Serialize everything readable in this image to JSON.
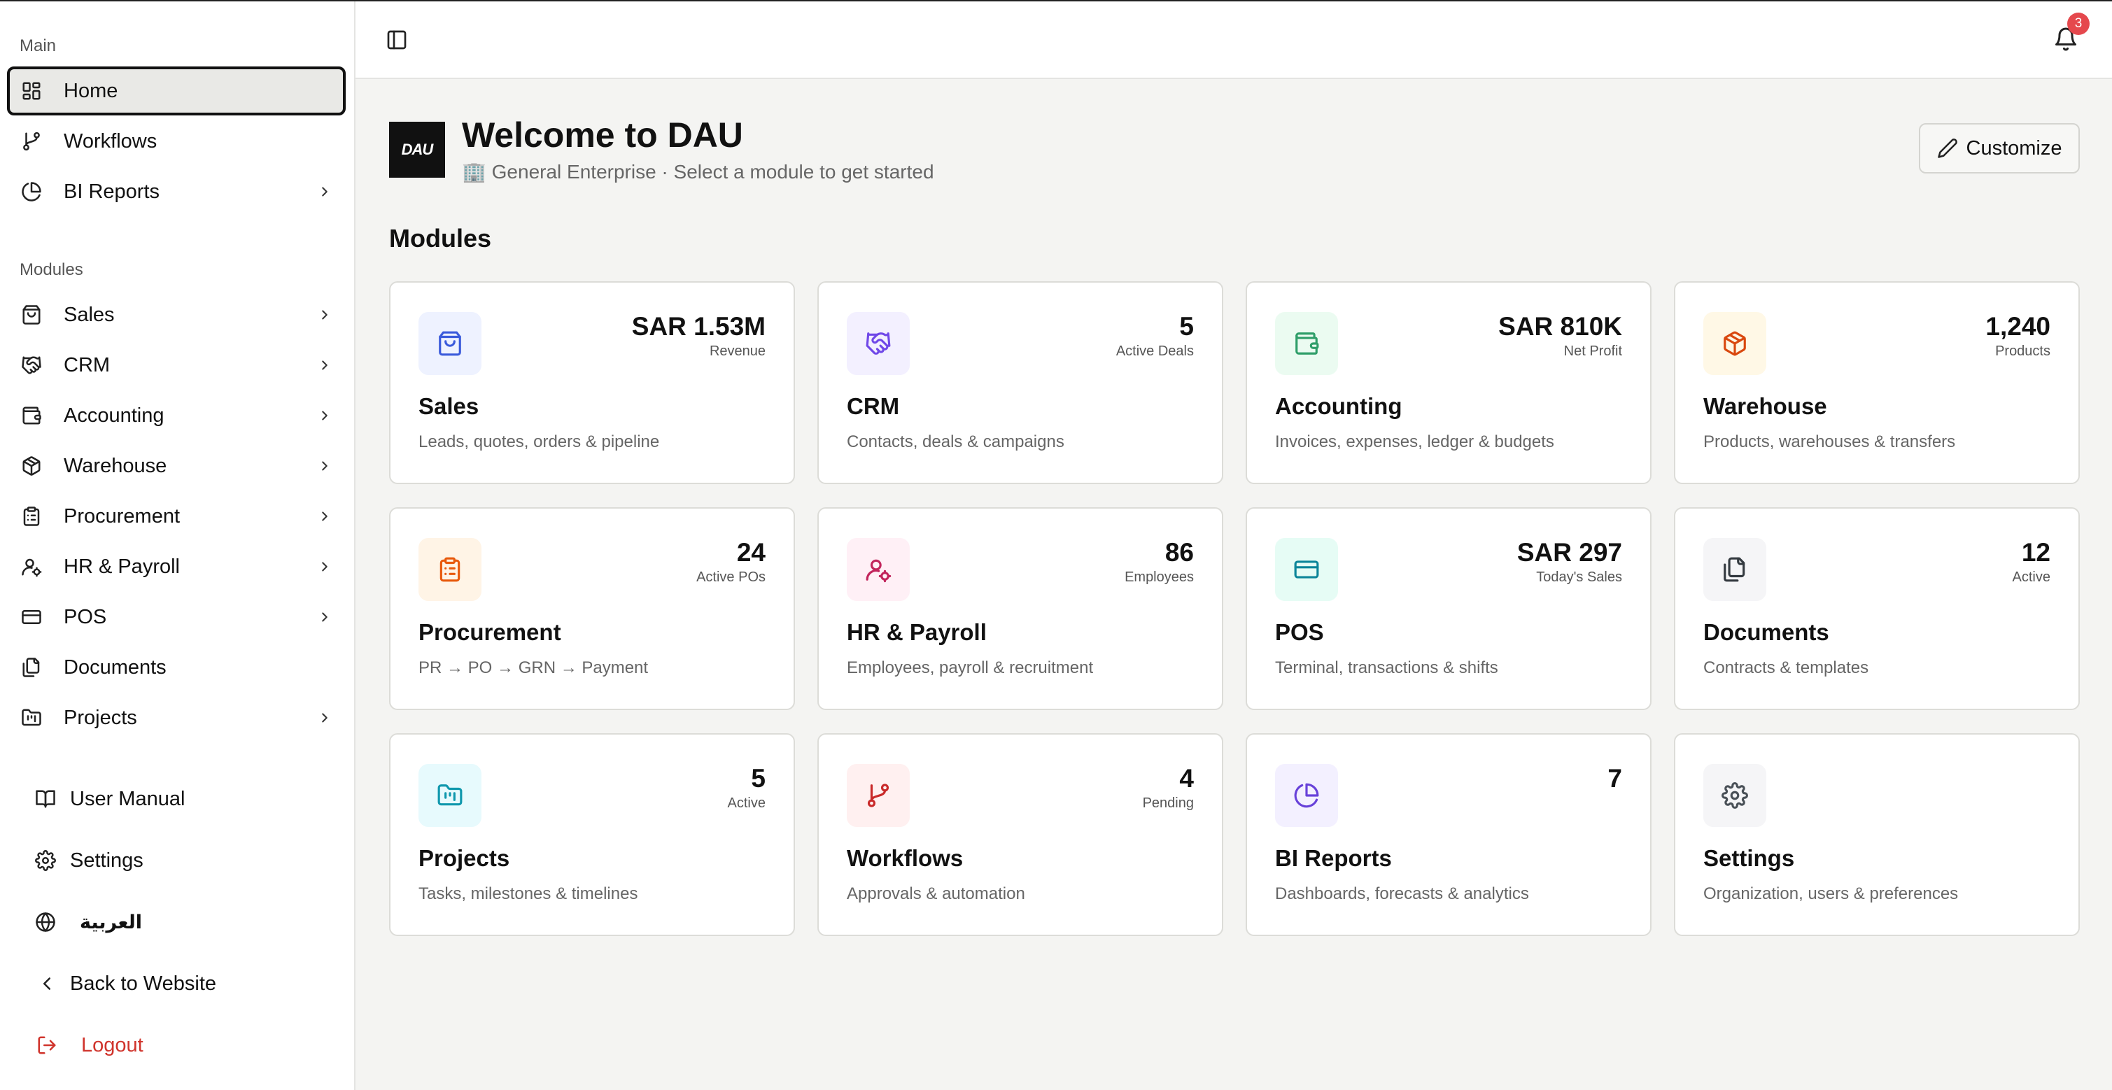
{
  "sidebar": {
    "main_label": "Main",
    "modules_label": "Modules",
    "main_items": [
      {
        "label": "Home",
        "icon": "grid-icon"
      },
      {
        "label": "Workflows",
        "icon": "git-branch-icon"
      },
      {
        "label": "BI Reports",
        "icon": "pie-chart-icon"
      }
    ],
    "module_items": [
      {
        "label": "Sales",
        "icon": "shopping-bag-icon"
      },
      {
        "label": "CRM",
        "icon": "handshake-icon"
      },
      {
        "label": "Accounting",
        "icon": "wallet-icon"
      },
      {
        "label": "Warehouse",
        "icon": "package-icon"
      },
      {
        "label": "Procurement",
        "icon": "clipboard-list-icon"
      },
      {
        "label": "HR & Payroll",
        "icon": "user-cog-icon"
      },
      {
        "label": "POS",
        "icon": "credit-card-icon"
      },
      {
        "label": "Documents",
        "icon": "files-icon"
      },
      {
        "label": "Projects",
        "icon": "folder-kanban-icon"
      }
    ],
    "footer_items": [
      {
        "label": "User Manual",
        "icon": "book-icon"
      },
      {
        "label": "Settings",
        "icon": "gear-icon"
      },
      {
        "label": "العربية",
        "icon": "globe-icon"
      },
      {
        "label": "Back to Website",
        "icon": "chevron-left-icon"
      },
      {
        "label": "Logout",
        "icon": "logout-icon"
      }
    ]
  },
  "header": {
    "notification_count": "3"
  },
  "welcome": {
    "logo_text": "DAU",
    "title": "Welcome to DAU",
    "subtitle": "🏢 General Enterprise · Select a module to get started",
    "customize_label": "Customize"
  },
  "modules_title": "Modules",
  "modules": [
    {
      "title": "Sales",
      "desc": "Leads, quotes, orders & pipeline",
      "value": "SAR 1.53M",
      "label": "Revenue",
      "icon": "shopping-bag-icon",
      "color": "#3b5bdb",
      "bg": "#eef2ff"
    },
    {
      "title": "CRM",
      "desc": "Contacts, deals & campaigns",
      "value": "5",
      "label": "Active Deals",
      "icon": "handshake-icon",
      "color": "#7048e8",
      "bg": "#f3f0ff"
    },
    {
      "title": "Accounting",
      "desc": "Invoices, expenses, ledger & budgets",
      "value": "SAR 810K",
      "label": "Net Profit",
      "icon": "wallet-icon",
      "color": "#2f9e69",
      "bg": "#ebfbf1"
    },
    {
      "title": "Warehouse",
      "desc": "Products, warehouses & transfers",
      "value": "1,240",
      "label": "Products",
      "icon": "package-icon",
      "color": "#d9480f",
      "bg": "#fff8e6"
    },
    {
      "title": "Procurement",
      "desc": "PR → PO → GRN → Payment",
      "value": "24",
      "label": "Active POs",
      "icon": "clipboard-list-icon",
      "color": "#e8590c",
      "bg": "#fff4e6"
    },
    {
      "title": "HR & Payroll",
      "desc": "Employees, payroll & recruitment",
      "value": "86",
      "label": "Employees",
      "icon": "user-cog-icon",
      "color": "#c2255c",
      "bg": "#fff0f6"
    },
    {
      "title": "POS",
      "desc": "Terminal, transactions & shifts",
      "value": "SAR 297",
      "label": "Today's Sales",
      "icon": "credit-card-icon",
      "color": "#0c8599",
      "bg": "#e6fcf5"
    },
    {
      "title": "Documents",
      "desc": "Contracts & templates",
      "value": "12",
      "label": "Active",
      "icon": "files-icon",
      "color": "#343a40",
      "bg": "#f5f5f7"
    },
    {
      "title": "Projects",
      "desc": "Tasks, milestones & timelines",
      "value": "5",
      "label": "Active",
      "icon": "folder-kanban-icon",
      "color": "#1098ad",
      "bg": "#e7fafd"
    },
    {
      "title": "Workflows",
      "desc": "Approvals & automation",
      "value": "4",
      "label": "Pending",
      "icon": "git-branch-icon",
      "color": "#c92a2a",
      "bg": "#fff0f0"
    },
    {
      "title": "BI Reports",
      "desc": "Dashboards, forecasts & analytics",
      "value": "7",
      "label": "",
      "icon": "pie-chart-icon",
      "color": "#6741d9",
      "bg": "#f3f0ff"
    },
    {
      "title": "Settings",
      "desc": "Organization, users & preferences",
      "value": "",
      "label": "",
      "icon": "gear-icon",
      "color": "#495057",
      "bg": "#f5f5f7"
    }
  ]
}
